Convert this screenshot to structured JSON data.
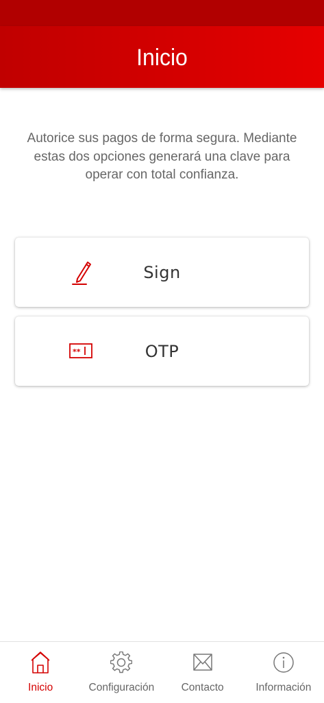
{
  "header": {
    "title": "Inicio"
  },
  "intro": {
    "text": "Autorice sus pagos de forma segura. Mediante estas dos opciones generará una clave para operar con total confianza."
  },
  "options": [
    {
      "label": "Sign",
      "icon": "pen-signature-icon"
    },
    {
      "label": "OTP",
      "icon": "password-field-icon"
    }
  ],
  "nav": {
    "items": [
      {
        "label": "Inicio",
        "icon": "home-icon",
        "active": true
      },
      {
        "label": "Configuración",
        "icon": "gear-icon",
        "active": false
      },
      {
        "label": "Contacto",
        "icon": "envelope-icon",
        "active": false
      },
      {
        "label": "Información",
        "icon": "info-icon",
        "active": false
      }
    ]
  },
  "colors": {
    "brand": "#d40000",
    "status_bar": "#b10000",
    "text_muted": "#666666",
    "text_dark": "#333333"
  }
}
